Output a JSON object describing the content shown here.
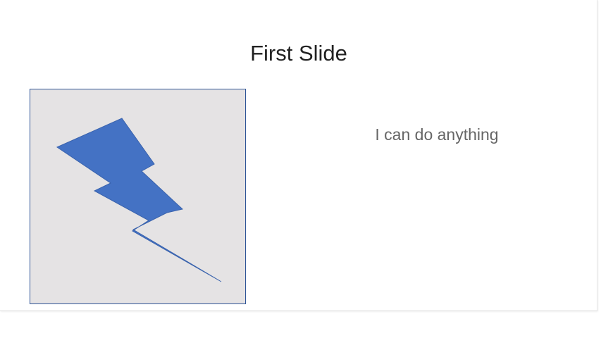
{
  "slide": {
    "title": "First Slide",
    "body_text": "I can do anything",
    "image": {
      "icon": "lightning-bolt-icon",
      "fill_color": "#4472c4",
      "background_color": "#e5e3e4",
      "border_color": "#2f5597"
    }
  },
  "colors": {
    "title_text": "#222222",
    "body_text": "#666666"
  }
}
